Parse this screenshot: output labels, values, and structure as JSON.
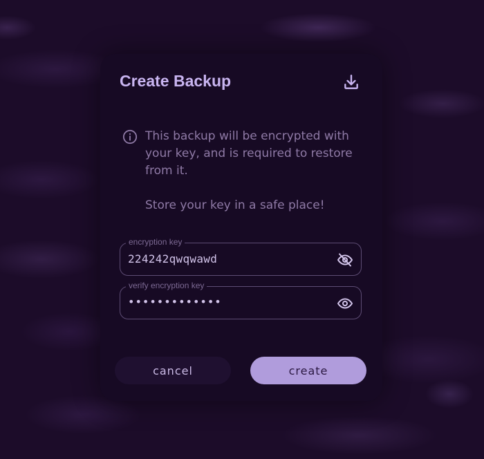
{
  "dialog": {
    "title": "Create Backup",
    "title_icon": "download-icon",
    "info_icon": "info-icon",
    "info_paragraphs": [
      "This backup will be encrypted with your key, and is required to restore from it.",
      "Store your key in a safe place!"
    ],
    "fields": [
      {
        "label": "encryption key",
        "value": "224242qwqwawd",
        "visibility_icon": "eye-off-icon"
      },
      {
        "label": "verify encryption key",
        "value": "•••••••••••••",
        "visibility_icon": "eye-icon"
      }
    ],
    "buttons": {
      "cancel": "cancel",
      "create": "create"
    }
  },
  "colors": {
    "accent": "#b09cdc",
    "title": "#c9b5f1",
    "dialog_bg": "#170a24"
  }
}
